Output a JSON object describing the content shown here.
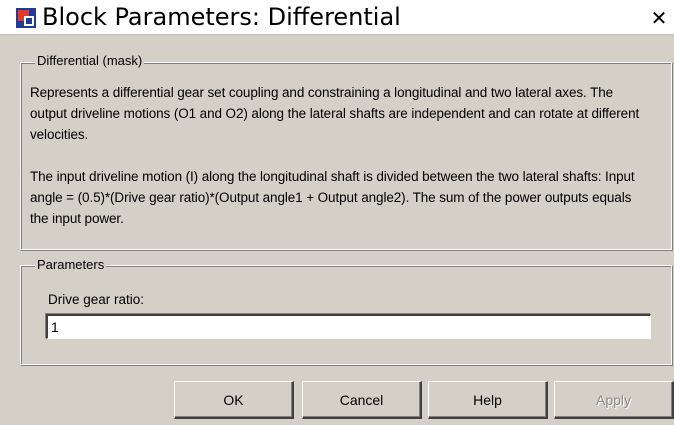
{
  "window": {
    "title": "Block Parameters: Differential",
    "close_glyph": "✕",
    "icon": "simulink-block-icon"
  },
  "mask_group": {
    "legend": "Differential (mask)",
    "description": [
      "Represents a differential gear set coupling and constraining a longitudinal and two lateral axes. The output driveline motions (O1 and O2) along the lateral shafts are independent and can rotate at different velocities.",
      "The input driveline motion (I) along the longitudinal shaft is divided between the two lateral shafts: Input angle = (0.5)*(Drive gear ratio)*(Output angle1 + Output angle2). The sum of the power outputs equals the input power."
    ]
  },
  "parameters_group": {
    "legend": "Parameters",
    "drive_gear_ratio": {
      "label": "Drive gear ratio:",
      "value": "1"
    }
  },
  "buttons": {
    "ok": "OK",
    "cancel": "Cancel",
    "help": "Help",
    "apply": "Apply"
  }
}
